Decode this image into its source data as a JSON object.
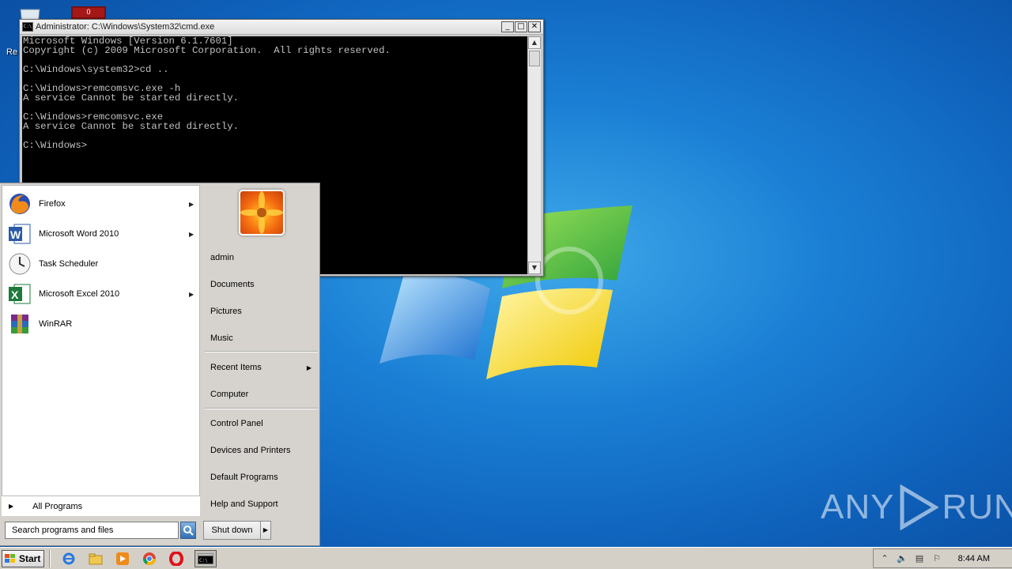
{
  "desktop": {
    "label_partial": "Re",
    "red_icon_text": "0",
    "watermark": {
      "text_left": "ANY",
      "text_right": "RUN"
    }
  },
  "cmd_window": {
    "title": "Administrator: C:\\Windows\\System32\\cmd.exe",
    "title_icon_text": "C:\\",
    "controls": {
      "minimize": "_",
      "maximize": "□",
      "close": "✕"
    },
    "console_text": "Microsoft Windows [Version 6.1.7601]\nCopyright (c) 2009 Microsoft Corporation.  All rights reserved.\n\nC:\\Windows\\system32>cd ..\n\nC:\\Windows>remcomsvc.exe -h\nA service Cannot be started directly.\n\nC:\\Windows>remcomsvc.exe\nA service Cannot be started directly.\n\nC:\\Windows>"
  },
  "start_menu": {
    "pinned": [
      {
        "label": "Firefox",
        "icon": "firefox-icon",
        "has_submenu": true
      },
      {
        "label": "Microsoft Word 2010",
        "icon": "word-icon",
        "has_submenu": true
      },
      {
        "label": "Task Scheduler",
        "icon": "task-scheduler-icon",
        "has_submenu": false
      },
      {
        "label": "Microsoft Excel 2010",
        "icon": "excel-icon",
        "has_submenu": true
      },
      {
        "label": "WinRAR",
        "icon": "winrar-icon",
        "has_submenu": false
      }
    ],
    "all_programs": "All Programs",
    "search_placeholder": "Search programs and files",
    "right_items": [
      {
        "label": "admin"
      },
      {
        "label": "Documents"
      },
      {
        "label": "Pictures"
      },
      {
        "label": "Music"
      },
      {
        "label": "Recent Items",
        "has_submenu": true
      },
      {
        "label": "Computer"
      },
      {
        "label": "Control Panel"
      },
      {
        "label": "Devices and Printers"
      },
      {
        "label": "Default Programs"
      },
      {
        "label": "Help and Support"
      }
    ],
    "shutdown_label": "Shut down"
  },
  "taskbar": {
    "start_label": "Start",
    "pinned_icons": [
      "ie-icon",
      "explorer-icon",
      "media-player-icon",
      "chrome-icon",
      "opera-icon"
    ],
    "active_task_icon": "cmd-icon",
    "tray_icons": [
      "show-hidden-icon",
      "volume-icon",
      "network-icon",
      "action-center-flag-icon"
    ],
    "clock": "8:44 AM"
  }
}
